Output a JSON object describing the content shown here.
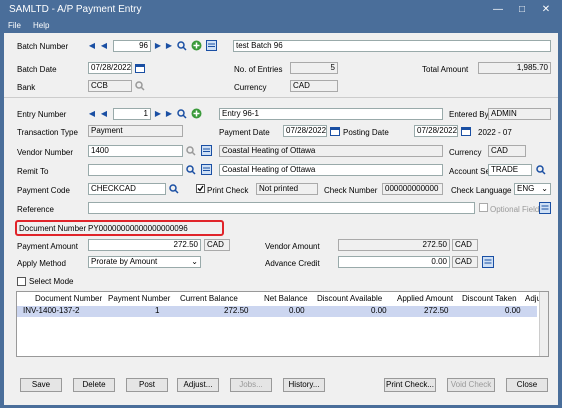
{
  "window": {
    "title": "SAMLTD - A/P Payment Entry",
    "menu": [
      "File",
      "Help"
    ]
  },
  "batch": {
    "number_label": "Batch Number",
    "number": "96",
    "description": "test Batch 96",
    "date_label": "Batch Date",
    "date": "07/28/2022",
    "entries_label": "No. of Entries",
    "entries": "5",
    "total_label": "Total Amount",
    "total": "1,985.70",
    "bank_label": "Bank",
    "bank": "CCB",
    "currency_label": "Currency",
    "currency": "CAD"
  },
  "entry": {
    "number_label": "Entry Number",
    "number": "1",
    "description": "Entry 96-1",
    "entered_by_label": "Entered By",
    "entered_by": "ADMIN",
    "type_label": "Transaction Type",
    "type": "Payment",
    "payment_date_label": "Payment Date",
    "payment_date": "07/28/2022",
    "posting_date_label": "Posting Date",
    "posting_date": "07/28/2022",
    "period": "2022 - 07",
    "vendor_label": "Vendor Number",
    "vendor": "1400",
    "vendor_name": "Coastal Heating of Ottawa",
    "currency_label": "Currency",
    "currency": "CAD",
    "remit_label": "Remit To",
    "remit_to": "",
    "remit_name": "Coastal Heating of Ottawa",
    "account_set_label": "Account Set",
    "account_set": "TRADE",
    "payment_code_label": "Payment Code",
    "payment_code": "CHECKCAD",
    "print_check_label": "Print Check",
    "print_status": "Not printed",
    "check_number_label": "Check Number",
    "check_number": "000000000000",
    "check_lang_label": "Check Language",
    "check_lang": "ENG",
    "reference_label": "Reference",
    "reference": "",
    "optional_fields_label": "Optional Fields",
    "document_label": "Document Number",
    "document_number": "PY00000000000000000096",
    "payment_amount_label": "Payment Amount",
    "payment_amount": "272.50",
    "payment_currency": "CAD",
    "vendor_amount_label": "Vendor Amount",
    "vendor_amount": "272.50",
    "vendor_currency": "CAD",
    "apply_method_label": "Apply Method",
    "apply_method": "Prorate by Amount",
    "advance_credit_label": "Advance Credit",
    "advance_credit": "0.00",
    "advance_currency": "CAD",
    "select_mode_label": "Select Mode"
  },
  "grid": {
    "headers": [
      "Document Number",
      "Payment Number",
      "Current Balance",
      "Net Balance",
      "Discount Available",
      "Applied Amount",
      "Discount Taken",
      "Adjus"
    ],
    "rows": [
      [
        "INV-1400-137-2",
        "1",
        "272.50",
        "0.00",
        "0.00",
        "272.50",
        "0.00",
        ""
      ]
    ]
  },
  "buttons": {
    "save": "Save",
    "delete": "Delete",
    "post": "Post",
    "adjust": "Adjust...",
    "jobs": "Jobs...",
    "history": "History...",
    "print_check": "Print Check...",
    "void_check": "Void Check",
    "close": "Close"
  }
}
